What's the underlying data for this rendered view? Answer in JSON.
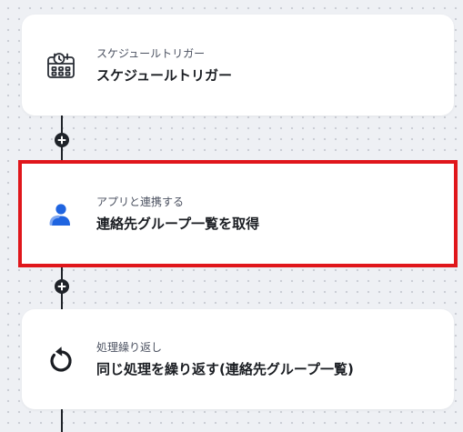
{
  "flow": {
    "steps": [
      {
        "category": "スケジュールトリガー",
        "title": "スケジュールトリガー",
        "icon": "calendar-clock-icon"
      },
      {
        "category": "アプリと連携する",
        "title": "連絡先グループ一覧を取得",
        "icon": "person-icon",
        "selected": true
      },
      {
        "category": "処理繰り返し",
        "title": "同じ処理を繰り返す(連絡先グループ一覧)",
        "icon": "repeat-arrow-icon"
      }
    ],
    "add_step_icon": "plus-icon",
    "colors": {
      "canvas": "#eef0f4",
      "card": "#ffffff",
      "connector": "#1f2329",
      "selection_border": "#e0161b",
      "app_icon_blue": "#1f64e0"
    }
  }
}
